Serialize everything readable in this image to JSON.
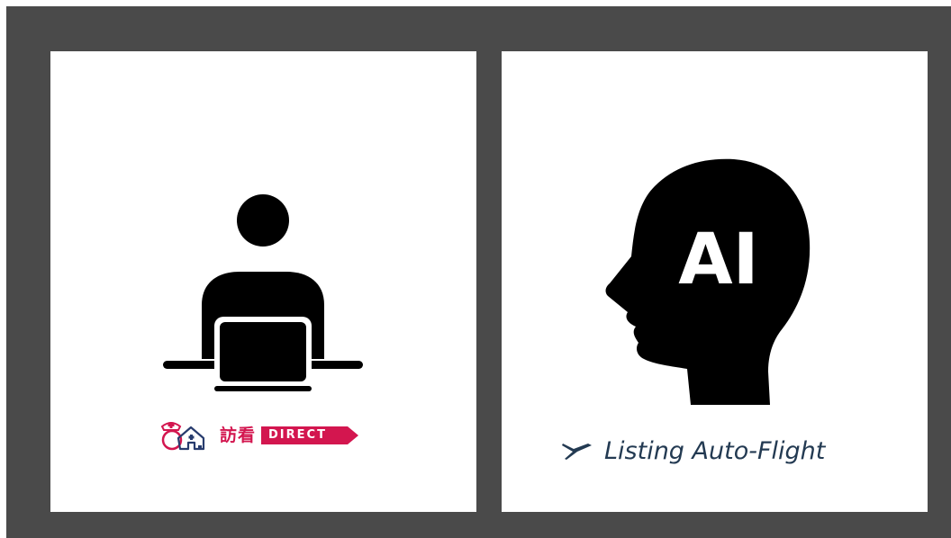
{
  "colors": {
    "frame": "#4a4a4a",
    "card": "#ffffff",
    "pictogram": "#000000",
    "hokan_brand": "#d3164f",
    "hokan_outline": "#283c6e",
    "laf_brand": "#233a52"
  },
  "cards": [
    {
      "pictogram": "person-at-laptop-icon",
      "logo": {
        "name": "訪看",
        "tag": "DIRECT",
        "mark": "nurse-house-icon"
      }
    },
    {
      "pictogram": "ai-head-icon",
      "pictogram_text": "AI",
      "logo": {
        "name": "Listing Auto-Flight",
        "mark": "airplane-icon"
      }
    }
  ]
}
